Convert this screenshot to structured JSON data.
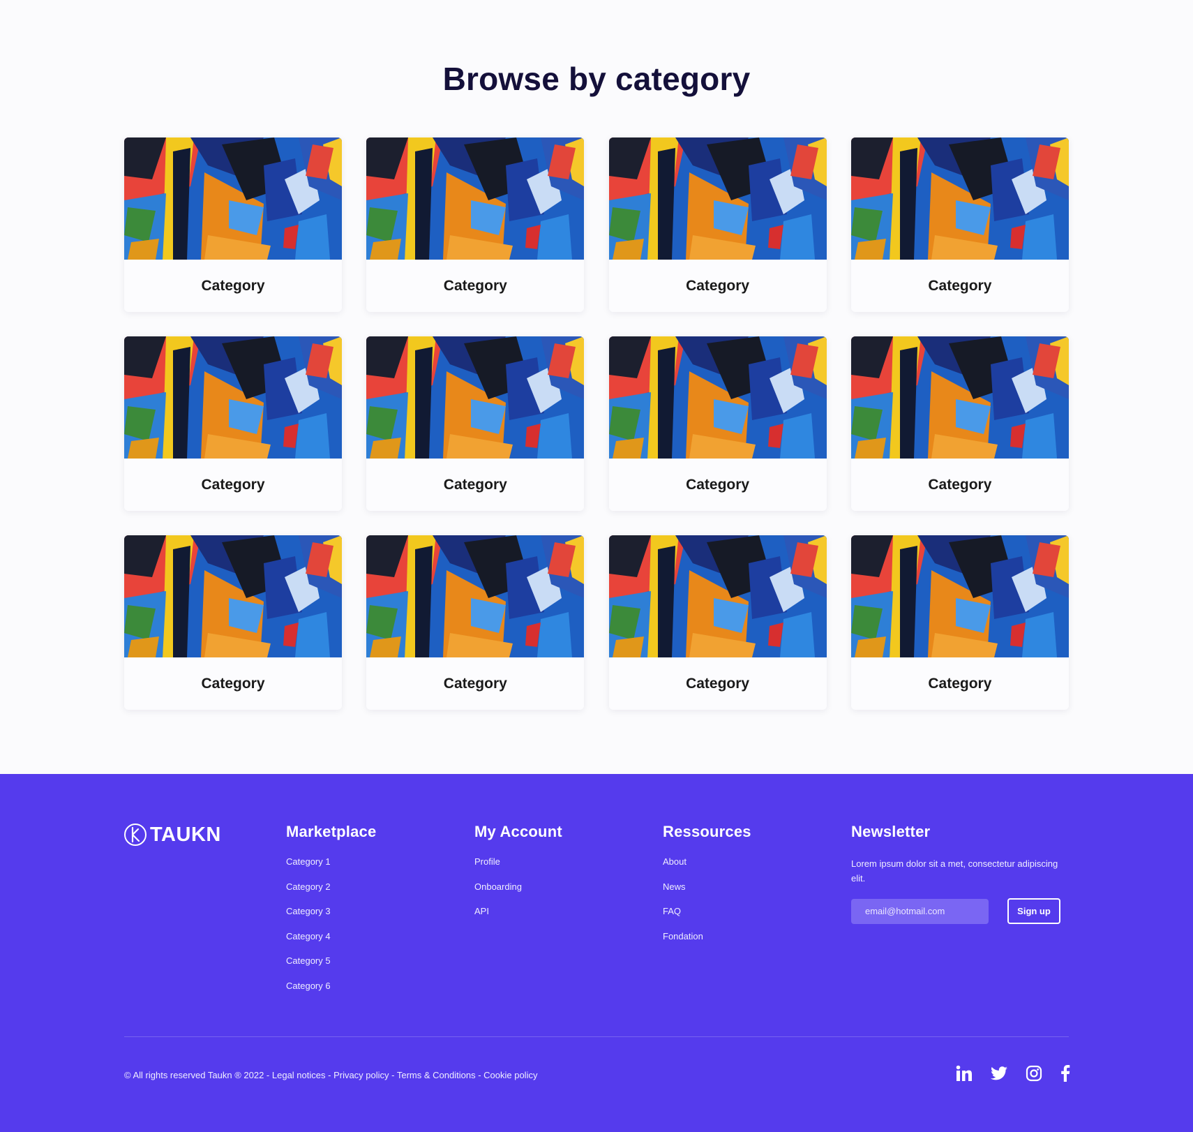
{
  "title": "Browse by category",
  "categories": [
    {
      "label": "Category"
    },
    {
      "label": "Category"
    },
    {
      "label": "Category"
    },
    {
      "label": "Category"
    },
    {
      "label": "Category"
    },
    {
      "label": "Category"
    },
    {
      "label": "Category"
    },
    {
      "label": "Category"
    },
    {
      "label": "Category"
    },
    {
      "label": "Category"
    },
    {
      "label": "Category"
    },
    {
      "label": "Category"
    }
  ],
  "footer": {
    "logo_text": "TAUKN",
    "marketplace": {
      "heading": "Marketplace",
      "items": [
        "Category 1",
        "Category 2",
        "Category 3",
        "Category 4",
        "Category 5",
        "Category 6"
      ]
    },
    "account": {
      "heading": "My Account",
      "items": [
        "Profile",
        "Onboarding",
        "API"
      ]
    },
    "resources": {
      "heading": "Ressources",
      "items": [
        "About",
        "News",
        "FAQ",
        "Fondation"
      ]
    },
    "newsletter": {
      "heading": "Newsletter",
      "text": "Lorem ipsum dolor sit a met, consectetur adipiscing elit.",
      "placeholder": "email@hotmail.com",
      "button": "Sign up"
    },
    "copyright": "© All rights reserved Taukn ® 2022 -",
    "legal_links": [
      "Legal notices",
      "Privacy policy",
      "Terms & Conditions",
      "Cookie policy"
    ],
    "socials": [
      "linkedin-icon",
      "twitter-icon",
      "instagram-icon",
      "facebook-icon"
    ],
    "colors": {
      "footer_bg": "#553bed",
      "title": "#14103a",
      "input_bg": "#7a66f3"
    }
  }
}
